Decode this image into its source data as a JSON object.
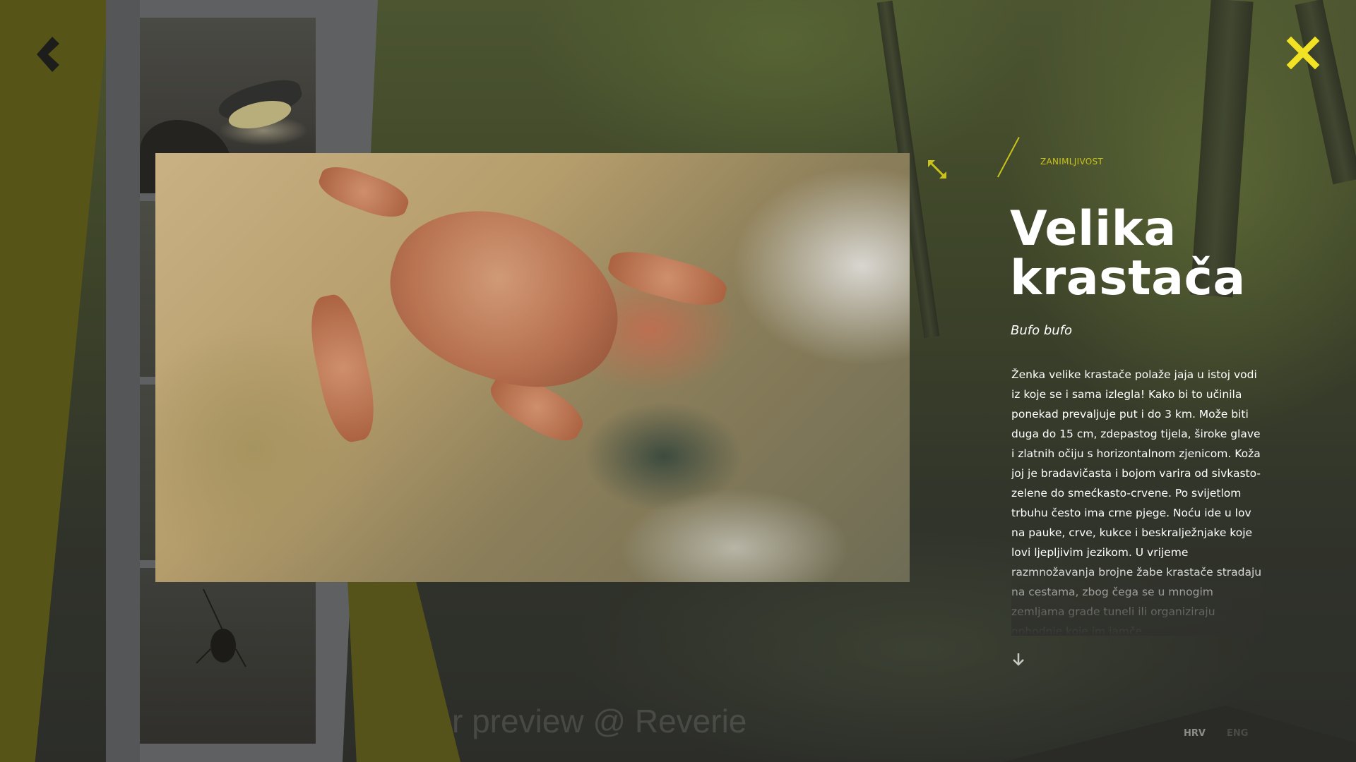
{
  "navigation": {
    "back_icon": "chevron-left-icon",
    "close_icon": "close-x-icon",
    "close_color": "#f2e224"
  },
  "gallery": {
    "thumbnails": [
      {
        "subject": "bird"
      },
      {
        "subject": "unknown"
      },
      {
        "subject": "unknown"
      },
      {
        "subject": "insect"
      }
    ]
  },
  "photo": {
    "subject": "toad",
    "next_icon": "chevron-right-icon",
    "expand_icon": "expand-arrows-icon"
  },
  "article": {
    "category": "ZANIMLJIVOST",
    "title": "Velika krastača",
    "latin_name": "Bufo bufo",
    "description": "Ženka velike krastače polaže jaja u istoj vodi iz koje se i sama izlegla! Kako bi to učinila ponekad prevaljuje put i do 3 km. Može biti duga do 15 cm, zdepastog tijela, široke glave i zlatnih očiju s horizontalnom zjenicom. Koža joj je bradavičasta i bojom varira od sivkasto-zelene do smećkasto-crvene. Po svijetlom trbuhu često ima crne pjege.  Noću ide u lov na pauke, crve, kukce i beskralježnjake koje lovi ljepljivim jezikom. U vrijeme razmnožavanja brojne žabe krastače stradaju na cestama, zbog čega se u mnogim zemljama grade tuneli ili organiziraju ophodnje koje im jamče",
    "scroll_icon": "arrow-down-icon",
    "accent_color": "#c9c31c"
  },
  "watermark": "r preview @ Reverie",
  "languages": {
    "hrv": "HRV",
    "eng": "ENG",
    "active": "HRV"
  }
}
